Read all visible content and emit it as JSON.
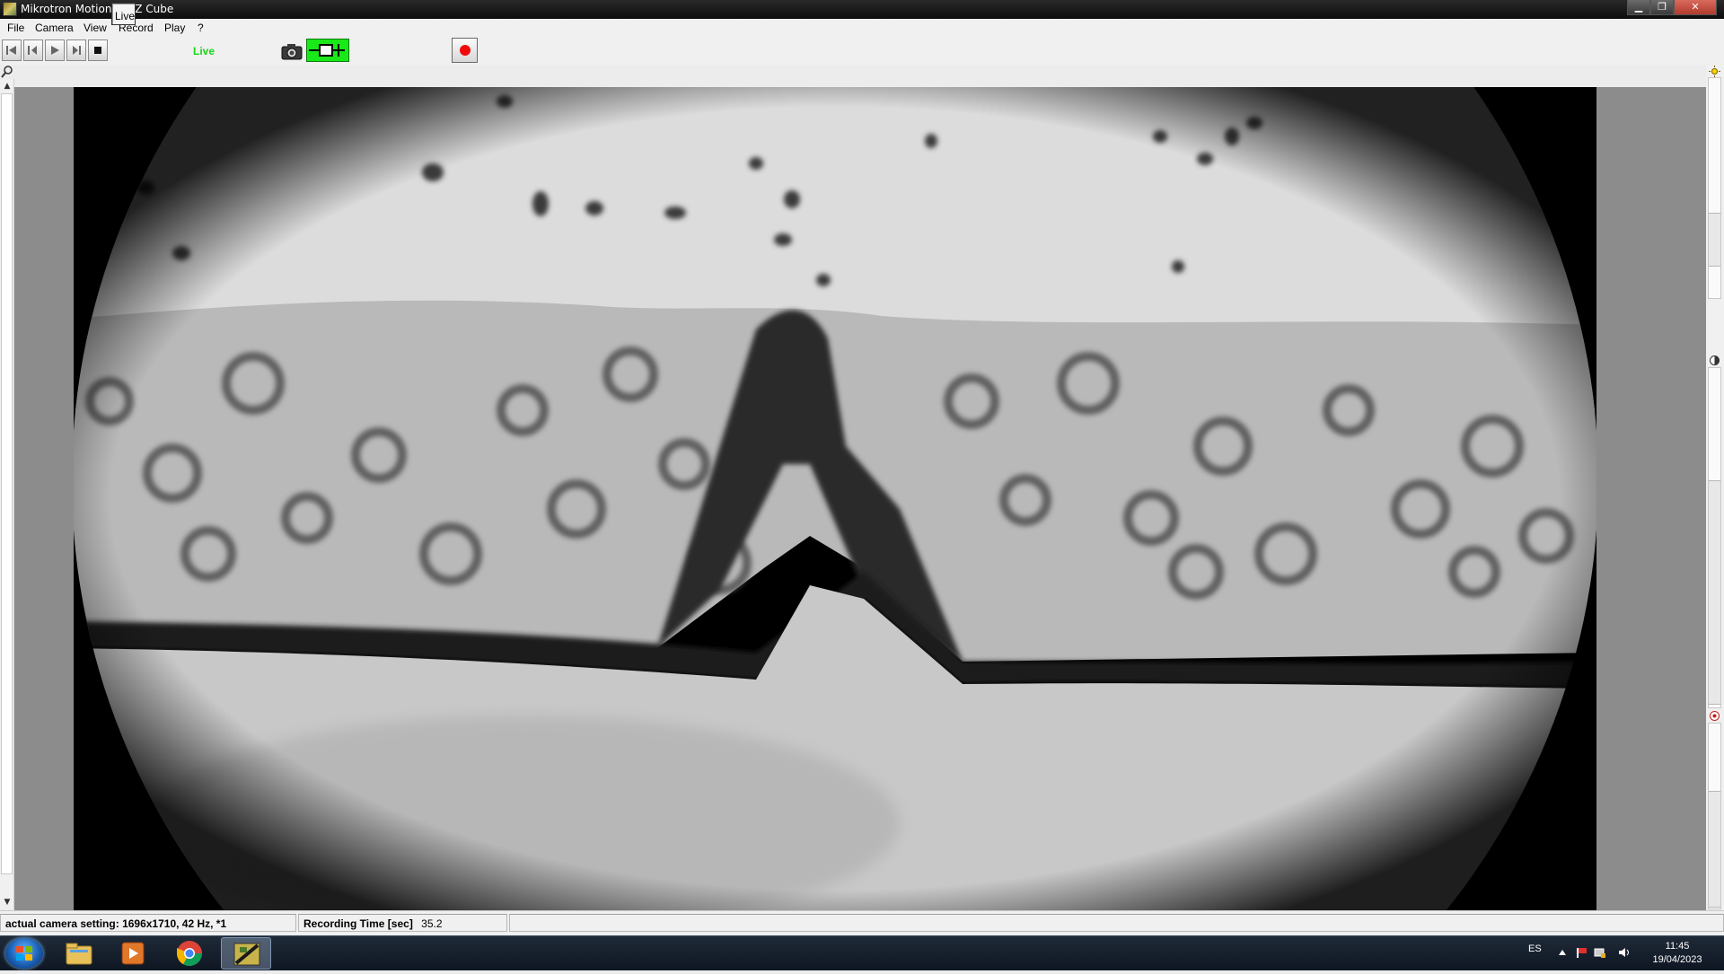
{
  "window": {
    "title": "Mikrotron MotionBLITZ Cube",
    "minimize_glyph": "▁",
    "maximize_glyph": "❐",
    "close_glyph": "✕"
  },
  "menu": [
    "File",
    "Camera",
    "View",
    "Record",
    "Play",
    "?"
  ],
  "toolbar": {
    "live_button_label": "Live",
    "live_status": "Live",
    "live_status_color": "#17d617",
    "record_color": "#f00a0a",
    "trigger_color": "#19e819"
  },
  "status_bar": {
    "camera_setting_label": "actual camera setting:",
    "camera_setting_value": "1696x1710, 42 Hz, *1",
    "recording_time_label": "Recording Time [sec]",
    "recording_time_value": "35.2"
  },
  "taskbar": {
    "apps": [
      "windows-explorer",
      "media-player",
      "chrome",
      "motionblitz"
    ],
    "language": "ES",
    "time": "11:45",
    "date": "19/04/2023"
  }
}
